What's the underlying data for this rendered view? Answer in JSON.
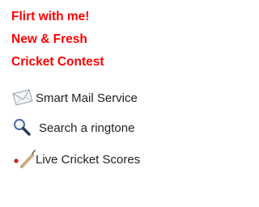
{
  "promos": [
    {
      "label": "Flirt with me!"
    },
    {
      "label": "New & Fresh"
    },
    {
      "label": "Cricket Contest"
    }
  ],
  "services": [
    {
      "label": "Smart Mail Service",
      "icon": "envelope-icon"
    },
    {
      "label": "Search a ringtone",
      "icon": "magnifier-icon"
    },
    {
      "label": "Live Cricket Scores",
      "icon": "cricket-bat-icon"
    }
  ],
  "colors": {
    "promo_text": "#ff0000",
    "service_text": "#222222",
    "background": "#ffffff"
  }
}
